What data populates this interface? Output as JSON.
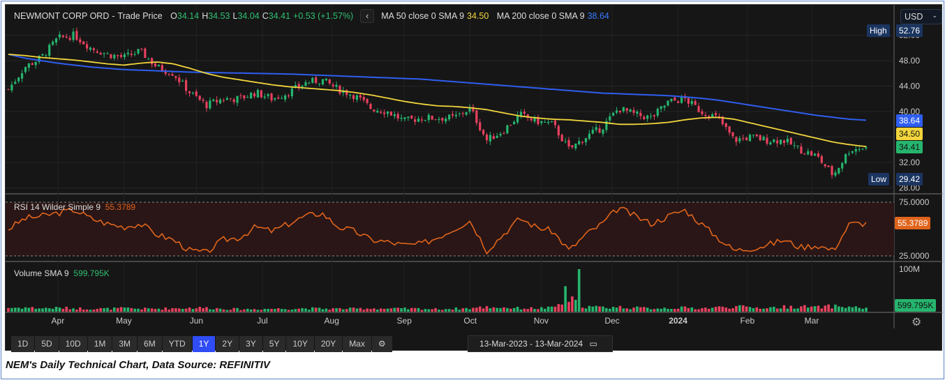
{
  "header": {
    "name": "NEWMONT CORP ORD",
    "sep": "-",
    "type": "Trade Price",
    "o_label": "O",
    "o": "34.14",
    "h_label": "H",
    "h": "34.53",
    "l_label": "L",
    "l": "34.04",
    "c_label": "C",
    "c": "34.41",
    "change": "+0.53 (+1.57%)",
    "back_icon": "‹",
    "ma50_label": "MA 50 close 0 SMA 9",
    "ma50": "34.50",
    "ma200_label": "MA 200 close 0 SMA 9",
    "ma200": "38.64"
  },
  "currency": {
    "value": "USD",
    "chevron": "⌄"
  },
  "tags": {
    "high_label": "High",
    "high": "52.76",
    "low_label": "Low",
    "low": "29.42",
    "ma200": "38.64",
    "ma50": "34.50",
    "last": "34.41",
    "rsi": "55.3789",
    "vol": "599.795K"
  },
  "rsi_panel": {
    "label": "RSI 14 Wilder Simple 9",
    "value": "55.3789"
  },
  "volume_panel": {
    "label": "Volume SMA 9",
    "value": "599.795K"
  },
  "range_buttons": [
    "1D",
    "5D",
    "10D",
    "1M",
    "3M",
    "6M",
    "YTD",
    "1Y",
    "2Y",
    "3Y",
    "5Y",
    "10Y",
    "20Y",
    "Max"
  ],
  "active_range": "1Y",
  "date_range": {
    "from": "13-Mar-2023",
    "sep": "-",
    "to": "13-Mar-2024"
  },
  "caption": "NEM's Daily Technical Chart, Data Source: REFINITIV",
  "colors": {
    "up": "#26b56e",
    "down": "#e8415e",
    "ma50": "#f2d53c",
    "ma200": "#2f5ef0",
    "rsi": "#e0641c"
  },
  "chart_data": {
    "type": "candlestick",
    "title": "NEWMONT CORP ORD - Trade Price",
    "x_unit": "week index from 13-Mar-2023",
    "price_ticks": [
      "52.00",
      "48.00",
      "44.00",
      "40.00",
      "36.00",
      "32.00",
      "28.00"
    ],
    "price_range": [
      27,
      54
    ],
    "months": [
      {
        "label": "Apr",
        "week": 3
      },
      {
        "label": "May",
        "week": 7
      },
      {
        "label": "Jun",
        "week": 11.4
      },
      {
        "label": "Jul",
        "week": 15.4
      },
      {
        "label": "Aug",
        "week": 19.6
      },
      {
        "label": "Sep",
        "week": 24
      },
      {
        "label": "Oct",
        "week": 28
      },
      {
        "label": "Nov",
        "week": 32.3
      },
      {
        "label": "Dec",
        "week": 36.6
      },
      {
        "label": "2024",
        "week": 40.6
      },
      {
        "label": "Feb",
        "week": 44.8
      },
      {
        "label": "Mar",
        "week": 48.7
      }
    ],
    "close_weekly": [
      43.5,
      47,
      48.5,
      51.5,
      52,
      50,
      49,
      48.5,
      49.5,
      47,
      46,
      43,
      41,
      42,
      42,
      43,
      42,
      43,
      44.5,
      45,
      43.5,
      42.5,
      40.5,
      40,
      38.5,
      39,
      39,
      39,
      40.5,
      35.5,
      37,
      39.5,
      38.5,
      38,
      34,
      36,
      37.5,
      40.5,
      39.5,
      39,
      41.5,
      42,
      40,
      39,
      35.5,
      36,
      35.5,
      35.5,
      34,
      33,
      30,
      34,
      34.41
    ],
    "ma50_weekly": [
      49,
      48.8,
      48.5,
      48.3,
      48.1,
      47.8,
      47.5,
      47.3,
      47.6,
      47.8,
      47.5,
      46.8,
      46,
      45.4,
      45,
      44.6,
      44.2,
      43.9,
      43.7,
      43.5,
      43.3,
      43,
      42.6,
      42.1,
      41.6,
      41.2,
      40.9,
      40.8,
      40.6,
      40.3,
      39.8,
      39.3,
      39,
      38.8,
      38.7,
      38.5,
      38.3,
      38,
      38,
      38.1,
      38.3,
      38.7,
      39,
      39.1,
      38.8,
      38.2,
      37.6,
      37,
      36.4,
      35.8,
      35.2,
      34.8,
      34.5
    ],
    "ma200_weekly": [
      49,
      48.4,
      48,
      47.6,
      47.3,
      47,
      46.8,
      46.6,
      46.5,
      46.4,
      46.3,
      46.2,
      46.15,
      46.1,
      46.05,
      46,
      45.95,
      45.9,
      45.8,
      45.7,
      45.6,
      45.5,
      45.4,
      45.3,
      45.2,
      45.1,
      44.9,
      44.7,
      44.5,
      44.3,
      44.1,
      43.9,
      43.7,
      43.5,
      43.3,
      43.1,
      42.9,
      42.8,
      42.7,
      42.6,
      42.5,
      42.3,
      42.1,
      41.8,
      41.4,
      41,
      40.6,
      40.2,
      39.8,
      39.4,
      39.1,
      38.8,
      38.64
    ],
    "rsi": {
      "ticks": [
        "75.0000",
        "25.0000"
      ],
      "range": [
        25,
        75
      ],
      "weekly": [
        50,
        60,
        62,
        65,
        68,
        60,
        55,
        52,
        55,
        45,
        40,
        30,
        28,
        40,
        42,
        52,
        48,
        55,
        62,
        65,
        52,
        48,
        40,
        38,
        35,
        36,
        42,
        50,
        58,
        30,
        45,
        60,
        52,
        48,
        30,
        45,
        55,
        70,
        62,
        55,
        62,
        68,
        55,
        42,
        30,
        32,
        35,
        40,
        33,
        35,
        30,
        55,
        55.38
      ]
    },
    "volume": {
      "ticks": [
        "100M"
      ],
      "max_millions": 100,
      "weekly_millions": [
        9,
        10,
        8,
        9,
        8,
        7,
        7,
        8,
        7,
        7,
        8,
        9,
        9,
        7,
        6,
        6,
        7,
        7,
        8,
        7,
        7,
        7,
        8,
        7,
        7,
        7,
        6,
        7,
        8,
        11,
        10,
        8,
        8,
        9,
        30,
        12,
        10,
        11,
        9,
        8,
        9,
        9,
        8,
        10,
        12,
        10,
        9,
        11,
        12,
        10,
        13,
        11,
        9
      ]
    }
  }
}
